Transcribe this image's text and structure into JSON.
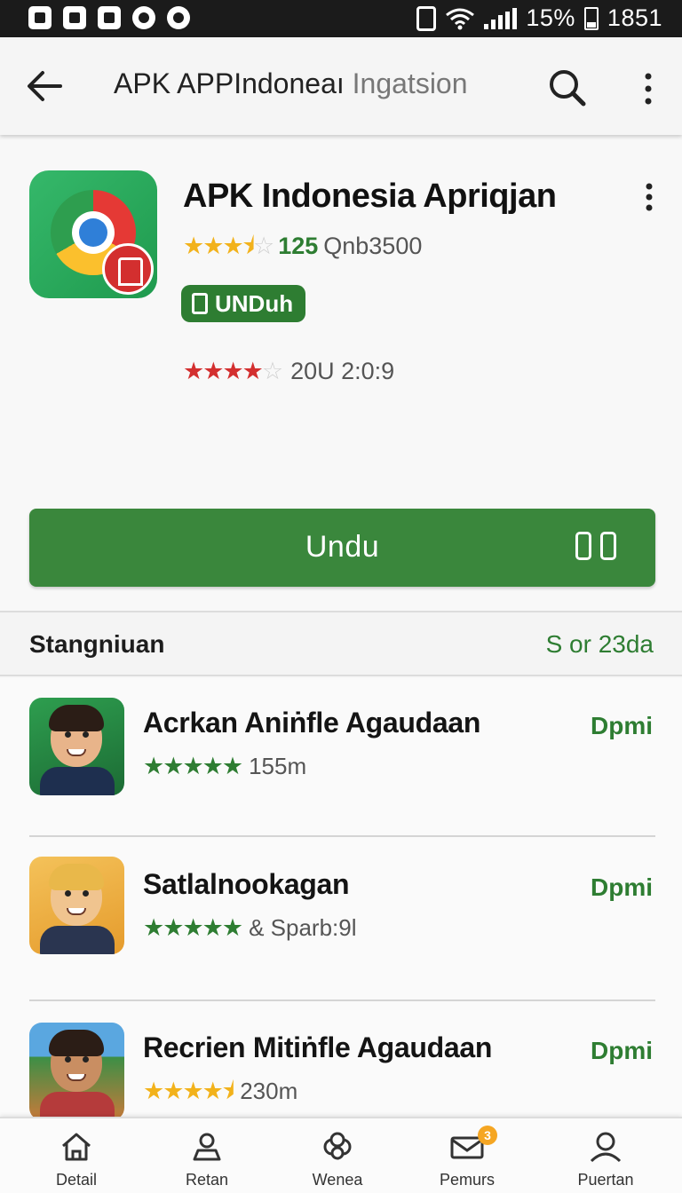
{
  "status_bar": {
    "battery": "15%",
    "time": "1851"
  },
  "app_bar": {
    "title_main": "APK APPIndoneaı",
    "title_muted": "Ingatsion"
  },
  "app": {
    "name": "APK Indonesia Apriqjan",
    "rating_stars": 3.5,
    "rating_count": "125",
    "rating_extra": "Qnb3500",
    "chip_label": "UNDuh",
    "rating2_stars": 4,
    "rating2_text": "20U 2:0:9",
    "install_label": "Undu"
  },
  "section": {
    "title": "Stangniuan",
    "link": "S or 23da"
  },
  "list": {
    "items": [
      {
        "title": "Acrkan Aniṅfle Agaudaan",
        "meta": "155m",
        "stars": 5,
        "action": "Dpmi"
      },
      {
        "title": "Satlalnookagan",
        "meta": "& Sparb:9l",
        "stars": 5,
        "action": "Dpmi"
      },
      {
        "title": "Recrien Mitiṅfle Agaudaan",
        "meta": "230m",
        "stars": 4.5,
        "action": "Dpmi"
      }
    ]
  },
  "bottom_nav": {
    "items": [
      {
        "label": "Detail",
        "icon": "home-icon"
      },
      {
        "label": "Retan",
        "icon": "person-tray-icon"
      },
      {
        "label": "Wenea",
        "icon": "cloud-icon"
      },
      {
        "label": "Pemurs",
        "icon": "mail-icon",
        "badge": "3"
      },
      {
        "label": "Puertan",
        "icon": "person-icon"
      }
    ]
  },
  "colors": {
    "accent_green": "#2e7d32",
    "star_gold": "#f2b21b",
    "star_red": "#d32f2f"
  }
}
